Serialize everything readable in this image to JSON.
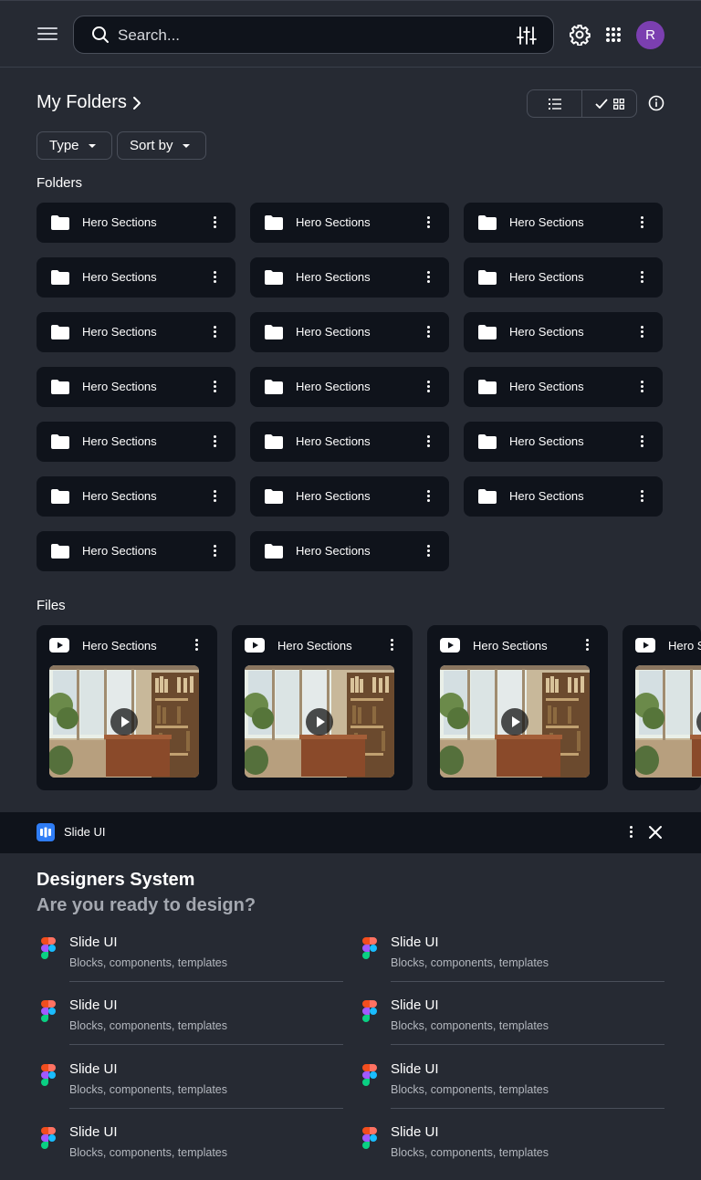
{
  "search": {
    "placeholder": "Search..."
  },
  "user": {
    "avatar_initial": "R"
  },
  "header": {
    "title": "My Folders"
  },
  "filters": {
    "type_label": "Type",
    "sort_label": "Sort by"
  },
  "sections": {
    "folders_label": "Folders",
    "files_label": "Files"
  },
  "folders": [
    {
      "name": "Hero Sections"
    },
    {
      "name": "Hero Sections"
    },
    {
      "name": "Hero Sections"
    },
    {
      "name": "Hero Sections"
    },
    {
      "name": "Hero Sections"
    },
    {
      "name": "Hero Sections"
    },
    {
      "name": "Hero Sections"
    },
    {
      "name": "Hero Sections"
    },
    {
      "name": "Hero Sections"
    },
    {
      "name": "Hero Sections"
    },
    {
      "name": "Hero Sections"
    },
    {
      "name": "Hero Sections"
    },
    {
      "name": "Hero Sections"
    },
    {
      "name": "Hero Sections"
    },
    {
      "name": "Hero Sections"
    },
    {
      "name": "Hero Sections"
    },
    {
      "name": "Hero Sections"
    },
    {
      "name": "Hero Sections"
    },
    {
      "name": "Hero Sections"
    },
    {
      "name": "Hero Sections"
    }
  ],
  "files": [
    {
      "name": "Hero Sections"
    },
    {
      "name": "Hero Sections"
    },
    {
      "name": "Hero Sections"
    },
    {
      "name": "Hero Sections"
    }
  ],
  "panel": {
    "app_name": "Slide UI",
    "title": "Designers System",
    "subtitle": "Are you ready to design?",
    "items": [
      {
        "title": "Slide UI",
        "desc": "Blocks, components, templates"
      },
      {
        "title": "Slide UI",
        "desc": "Blocks, components, templates"
      },
      {
        "title": "Slide UI",
        "desc": "Blocks, components, templates"
      },
      {
        "title": "Slide UI",
        "desc": "Blocks, components, templates"
      },
      {
        "title": "Slide UI",
        "desc": "Blocks, components, templates"
      },
      {
        "title": "Slide UI",
        "desc": "Blocks, components, templates"
      },
      {
        "title": "Slide UI",
        "desc": "Blocks, components, templates"
      },
      {
        "title": "Slide UI",
        "desc": "Blocks, components, templates"
      }
    ]
  },
  "icons": [
    "menu-icon",
    "search-icon",
    "tune-icon",
    "gear-icon",
    "apps-grid-icon",
    "chevron-right-icon",
    "list-view-icon",
    "check-icon",
    "grid-view-icon",
    "info-icon",
    "folder-icon",
    "kebab-icon",
    "youtube-icon",
    "play-icon",
    "slide-ui-logo-icon",
    "close-icon",
    "figma-icon"
  ],
  "colors": {
    "background": "#262a33",
    "card": "#0f131b",
    "avatar": "#7b3fb0",
    "brand_blue": "#2f7df6",
    "muted_text": "#a4a8b0"
  }
}
